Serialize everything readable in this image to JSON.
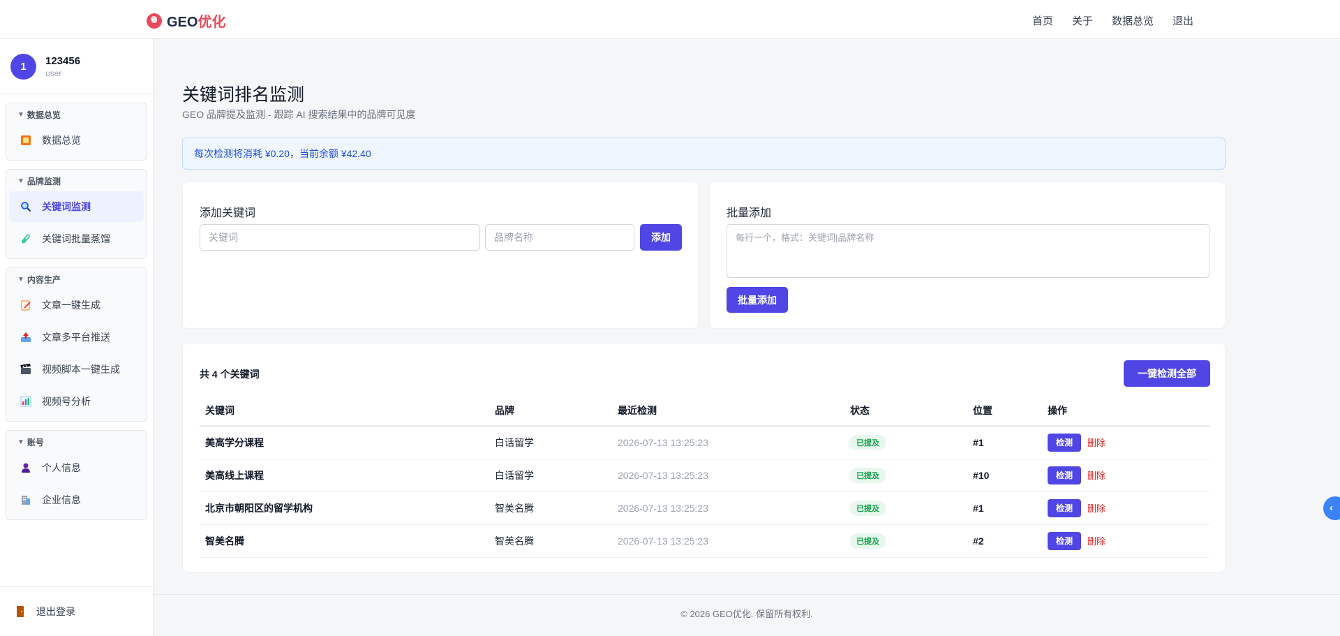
{
  "header": {
    "logo_prefix": "GEO",
    "logo_suffix": "优化",
    "nav": [
      "首页",
      "关于",
      "数据总览",
      "退出"
    ]
  },
  "user": {
    "avatar": "1",
    "name": "123456",
    "role": "user"
  },
  "sidebar": {
    "groups": [
      {
        "title": "数据总览",
        "items": [
          {
            "label": "数据总览",
            "icon": "dashboard-icon"
          }
        ]
      },
      {
        "title": "品牌监测",
        "items": [
          {
            "label": "关键词监测",
            "icon": "search-icon",
            "active": true
          },
          {
            "label": "关键词批量蒸馏",
            "icon": "test-tube-icon"
          }
        ]
      },
      {
        "title": "内容生产",
        "items": [
          {
            "label": "文章一键生成",
            "icon": "document-pen-icon"
          },
          {
            "label": "文章多平台推送",
            "icon": "outbox-icon"
          },
          {
            "label": "视频脚本一键生成",
            "icon": "clapper-icon"
          },
          {
            "label": "视频号分析",
            "icon": "bar-chart-icon"
          }
        ]
      },
      {
        "title": "账号",
        "items": [
          {
            "label": "个人信息",
            "icon": "person-icon"
          },
          {
            "label": "企业信息",
            "icon": "building-icon"
          }
        ]
      }
    ],
    "logout": "退出登录"
  },
  "page": {
    "title": "关键词排名监测",
    "subtitle": "GEO 品牌提及监测 - 跟踪 AI 搜索结果中的品牌可见度",
    "notice": "每次检测将消耗 ¥0.20，当前余额 ¥42.40"
  },
  "add_card": {
    "title": "添加关键词",
    "keyword_placeholder": "关键词",
    "brand_placeholder": "品牌名称",
    "add_button": "添加"
  },
  "batch_card": {
    "title": "批量添加",
    "placeholder": "每行一个，格式：关键词|品牌名称",
    "button": "批量添加"
  },
  "list": {
    "count_text": "共 4 个关键词",
    "check_all": "一键检测全部",
    "headers": [
      "关键词",
      "品牌",
      "最近检测",
      "状态",
      "位置",
      "操作"
    ],
    "check_label": "检测",
    "delete_label": "删除",
    "rows": [
      {
        "keyword": "美高学分课程",
        "brand": "白话留学",
        "time": "2026-07-13 13:25:23",
        "status": "已提及",
        "position": "#1"
      },
      {
        "keyword": "美高线上课程",
        "brand": "白话留学",
        "time": "2026-07-13 13:25:23",
        "status": "已提及",
        "position": "#10"
      },
      {
        "keyword": "北京市朝阳区的留学机构",
        "brand": "智美名腾",
        "time": "2026-07-13 13:25:23",
        "status": "已提及",
        "position": "#1"
      },
      {
        "keyword": "智美名腾",
        "brand": "智美名腾",
        "time": "2026-07-13 13:25:23",
        "status": "已提及",
        "position": "#2"
      }
    ]
  },
  "footer": "© 2026 GEO优化. 保留所有权利.",
  "colors": {
    "primary": "#4f46e5",
    "brand_red": "#e8495b",
    "success": "#16a34a",
    "danger": "#dc2626",
    "info_bg": "#eff6ff"
  }
}
